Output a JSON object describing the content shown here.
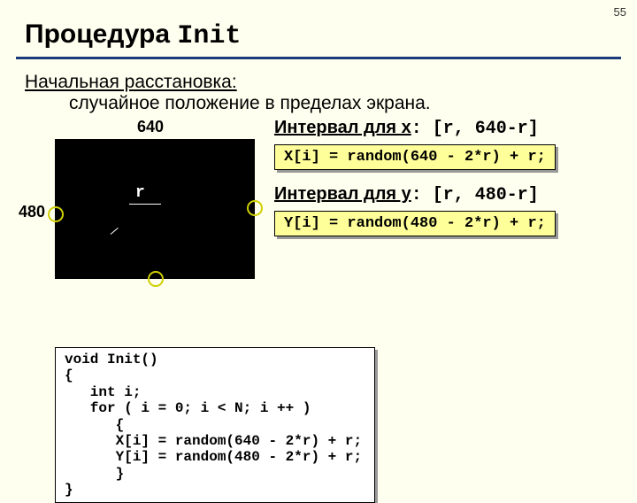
{
  "page_number": "55",
  "title_prefix": "Процедура ",
  "title_mono": "Init",
  "subtitle": "Начальная расстановка:",
  "subline": "случайное положение в пределах экрана.",
  "dim_640": "640",
  "dim_480": "480",
  "r_label": "r",
  "interval_x_label": "Интервал для x",
  "interval_x_value": ": [r, 640-r]",
  "formula_x": "X[i] = random(640 - 2*r) + r;",
  "interval_y_label": "Интервал для y",
  "interval_y_value": ": [r, 480-r]",
  "formula_y": "Y[i] = random(480 - 2*r) + r;",
  "code": "void Init()\n{\n   int i;\n   for ( i = 0; i < N; i ++ )\n      {\n      X[i] = random(640 - 2*r) + r;\n      Y[i] = random(480 - 2*r) + r;\n      }\n}"
}
